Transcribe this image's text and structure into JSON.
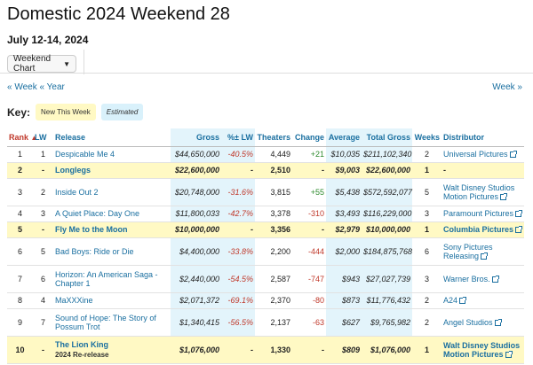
{
  "page": {
    "title": "Domestic 2024 Weekend 28",
    "date_range": "July 12-14, 2024",
    "selector_label": "Weekend Chart",
    "nav_week_prev": "« Week",
    "nav_year_prev": "« Year",
    "nav_week_next": "Week »"
  },
  "key": {
    "label": "Key:",
    "new_this_week": "New This Week",
    "estimated": "Estimated"
  },
  "table": {
    "headers": {
      "rank": "Rank",
      "lw": "LW",
      "release": "Release",
      "gross": "Gross",
      "pct_lw": "%± LW",
      "theaters": "Theaters",
      "change": "Change",
      "average": "Average",
      "total_gross": "Total Gross",
      "weeks": "Weeks",
      "distributor": "Distributor"
    },
    "rows": [
      {
        "rank": "1",
        "lw": "1",
        "release": "Despicable Me 4",
        "sub": "",
        "gross": "$44,650,000",
        "pct": "-40.5%",
        "theaters": "4,449",
        "change": "+21",
        "average": "$10,035",
        "total": "$211,102,340",
        "weeks": "2",
        "distributor": "Universal Pictures",
        "new": false,
        "tall": false
      },
      {
        "rank": "2",
        "lw": "-",
        "release": "Longlegs",
        "sub": "",
        "gross": "$22,600,000",
        "pct": "-",
        "theaters": "2,510",
        "change": "-",
        "average": "$9,003",
        "total": "$22,600,000",
        "weeks": "1",
        "distributor": "-",
        "new": true,
        "tall": false
      },
      {
        "rank": "3",
        "lw": "2",
        "release": "Inside Out 2",
        "sub": "",
        "gross": "$20,748,000",
        "pct": "-31.6%",
        "theaters": "3,815",
        "change": "+55",
        "average": "$5,438",
        "total": "$572,592,077",
        "weeks": "5",
        "distributor": "Walt Disney Studios Motion Pictures",
        "new": false,
        "tall": true
      },
      {
        "rank": "4",
        "lw": "3",
        "release": "A Quiet Place: Day One",
        "sub": "",
        "gross": "$11,800,033",
        "pct": "-42.7%",
        "theaters": "3,378",
        "change": "-310",
        "average": "$3,493",
        "total": "$116,229,000",
        "weeks": "3",
        "distributor": "Paramount Pictures",
        "new": false,
        "tall": false
      },
      {
        "rank": "5",
        "lw": "-",
        "release": "Fly Me to the Moon",
        "sub": "",
        "gross": "$10,000,000",
        "pct": "-",
        "theaters": "3,356",
        "change": "-",
        "average": "$2,979",
        "total": "$10,000,000",
        "weeks": "1",
        "distributor": "Columbia Pictures",
        "new": true,
        "tall": false
      },
      {
        "rank": "6",
        "lw": "5",
        "release": "Bad Boys: Ride or Die",
        "sub": "",
        "gross": "$4,400,000",
        "pct": "-33.8%",
        "theaters": "2,200",
        "change": "-444",
        "average": "$2,000",
        "total": "$184,875,768",
        "weeks": "6",
        "distributor": "Sony Pictures Releasing",
        "new": false,
        "tall": true
      },
      {
        "rank": "7",
        "lw": "6",
        "release": "Horizon: An American Saga - Chapter 1",
        "sub": "",
        "gross": "$2,440,000",
        "pct": "-54.5%",
        "theaters": "2,587",
        "change": "-747",
        "average": "$943",
        "total": "$27,027,739",
        "weeks": "3",
        "distributor": "Warner Bros.",
        "new": false,
        "tall": true
      },
      {
        "rank": "8",
        "lw": "4",
        "release": "MaXXXine",
        "sub": "",
        "gross": "$2,071,372",
        "pct": "-69.1%",
        "theaters": "2,370",
        "change": "-80",
        "average": "$873",
        "total": "$11,776,432",
        "weeks": "2",
        "distributor": "A24",
        "new": false,
        "tall": false
      },
      {
        "rank": "9",
        "lw": "7",
        "release": "Sound of Hope: The Story of Possum Trot",
        "sub": "",
        "gross": "$1,340,415",
        "pct": "-56.5%",
        "theaters": "2,137",
        "change": "-63",
        "average": "$627",
        "total": "$9,765,982",
        "weeks": "2",
        "distributor": "Angel Studios",
        "new": false,
        "tall": true
      },
      {
        "rank": "10",
        "lw": "-",
        "release": "The Lion King",
        "sub": "2024 Re-release",
        "gross": "$1,076,000",
        "pct": "-",
        "theaters": "1,330",
        "change": "-",
        "average": "$809",
        "total": "$1,076,000",
        "weeks": "1",
        "distributor": "Walt Disney Studios Motion Pictures",
        "new": true,
        "tall": true
      }
    ]
  }
}
